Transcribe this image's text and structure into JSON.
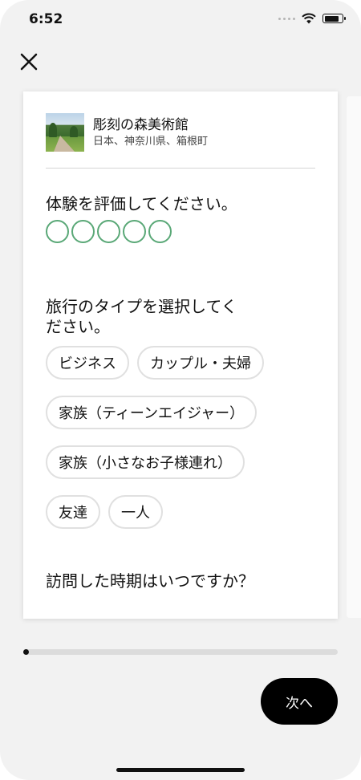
{
  "status_bar": {
    "time": "6:52"
  },
  "place": {
    "name": "彫刻の森美術館",
    "location": "日本、神奈川県、箱根町"
  },
  "rating_question": {
    "label": "体験を評価してください。",
    "max": 5,
    "selected": 0
  },
  "trip_type": {
    "label": "旅行のタイプを選択してください。",
    "options": [
      "ビジネス",
      "カップル・夫婦",
      "家族（ティーンエイジャー）",
      "家族（小さなお子様連れ）",
      "友達",
      "一人"
    ]
  },
  "visit_question": {
    "label": "訪問した時期はいつですか？"
  },
  "progress": {
    "value": 0.01
  },
  "next_button": {
    "label": "次へ"
  },
  "colors": {
    "rating_outline": "#5aa877",
    "primary": "#000000",
    "chip_border": "#e0e0e0"
  }
}
